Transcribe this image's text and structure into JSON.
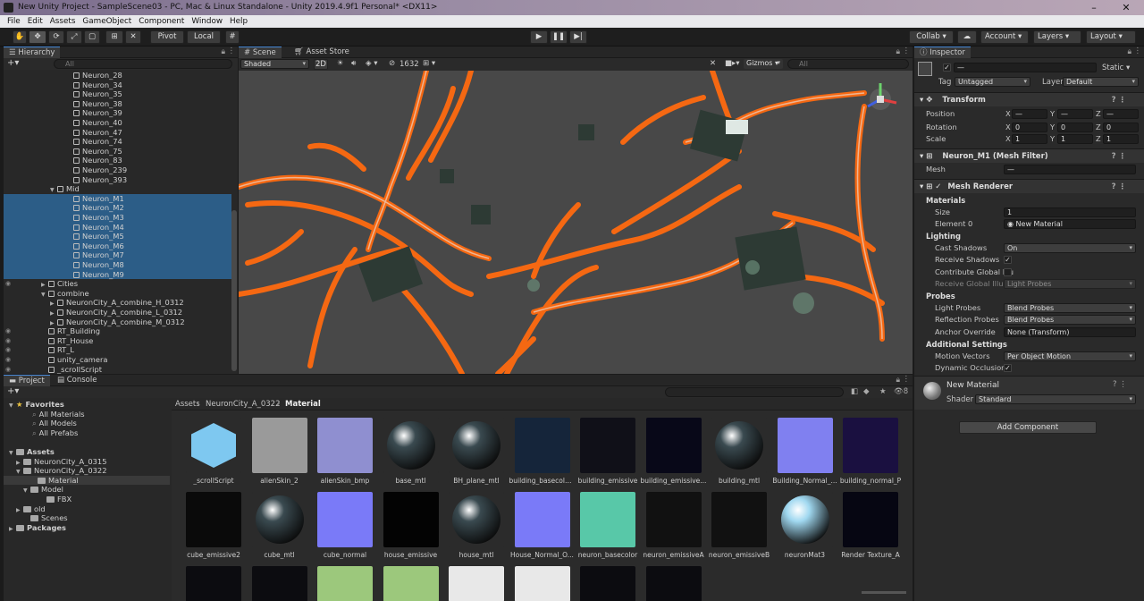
{
  "window": {
    "title": "New Unity Project - SampleScene03 - PC, Mac & Linux Standalone - Unity 2019.4.9f1 Personal* <DX11>"
  },
  "menu": [
    "File",
    "Edit",
    "Assets",
    "GameObject",
    "Component",
    "Window",
    "Help"
  ],
  "toolbar": {
    "pivot": "Pivot",
    "local": "Local",
    "collab": "Collab ▾",
    "account": "Account",
    "layers": "Layers",
    "layout": "Layout"
  },
  "hierarchy": {
    "tab": "Hierarchy",
    "search": "All",
    "rows": [
      {
        "label": "Neuron_28",
        "indent": 70,
        "sel": false
      },
      {
        "label": "Neuron_34",
        "indent": 70,
        "sel": false
      },
      {
        "label": "Neuron_35",
        "indent": 70,
        "sel": false
      },
      {
        "label": "Neuron_38",
        "indent": 70,
        "sel": false
      },
      {
        "label": "Neuron_39",
        "indent": 70,
        "sel": false
      },
      {
        "label": "Neuron_40",
        "indent": 70,
        "sel": false
      },
      {
        "label": "Neuron_47",
        "indent": 70,
        "sel": false
      },
      {
        "label": "Neuron_74",
        "indent": 70,
        "sel": false
      },
      {
        "label": "Neuron_75",
        "indent": 70,
        "sel": false
      },
      {
        "label": "Neuron_83",
        "indent": 70,
        "sel": false
      },
      {
        "label": "Neuron_239",
        "indent": 70,
        "sel": false
      },
      {
        "label": "Neuron_393",
        "indent": 70,
        "sel": false
      },
      {
        "label": "Mid",
        "indent": 52,
        "sel": false,
        "arrow": "▼"
      },
      {
        "label": "Neuron_M1",
        "indent": 70,
        "sel": true
      },
      {
        "label": "Neuron_M2",
        "indent": 70,
        "sel": true
      },
      {
        "label": "Neuron_M3",
        "indent": 70,
        "sel": true
      },
      {
        "label": "Neuron_M4",
        "indent": 70,
        "sel": true
      },
      {
        "label": "Neuron_M5",
        "indent": 70,
        "sel": true
      },
      {
        "label": "Neuron_M6",
        "indent": 70,
        "sel": true
      },
      {
        "label": "Neuron_M7",
        "indent": 70,
        "sel": true
      },
      {
        "label": "Neuron_M8",
        "indent": 70,
        "sel": true
      },
      {
        "label": "Neuron_M9",
        "indent": 70,
        "sel": true
      },
      {
        "label": "Cities",
        "indent": 42,
        "sel": false,
        "arrow": "▶",
        "eye": true
      },
      {
        "label": "combine",
        "indent": 42,
        "sel": false,
        "arrow": "▼"
      },
      {
        "label": "NeuronCity_A_combine_H_0312",
        "indent": 52,
        "sel": false,
        "arrow": "▶"
      },
      {
        "label": "NeuronCity_A_combine_L_0312",
        "indent": 52,
        "sel": false,
        "arrow": "▶"
      },
      {
        "label": "NeuronCity_A_combine_M_0312",
        "indent": 52,
        "sel": false,
        "arrow": "▶"
      },
      {
        "label": "RT_Building",
        "indent": 42,
        "sel": false,
        "eye": true
      },
      {
        "label": "RT_House",
        "indent": 42,
        "sel": false,
        "eye": true
      },
      {
        "label": "RT_L",
        "indent": 42,
        "sel": false,
        "eye": true
      },
      {
        "label": "unity_camera",
        "indent": 42,
        "sel": false,
        "eye": true
      },
      {
        "label": "_scrollScript",
        "indent": 42,
        "sel": false,
        "eye": true
      }
    ]
  },
  "scene": {
    "tab_scene": "Scene",
    "tab_store": "Asset Store",
    "shading": "Shaded",
    "mode2d": "2D",
    "count": "1632",
    "gizmos": "Gizmos ▾",
    "search": "All"
  },
  "inspector": {
    "tab": "Inspector",
    "name": "—",
    "static": "Static ▾",
    "tag_label": "Tag",
    "tag": "Untagged",
    "layer_label": "Layer",
    "layer": "Default",
    "transform": "Transform",
    "position": "Position",
    "rotation": "Rotation",
    "scale": "Scale",
    "pos": [
      "—",
      "—",
      "—"
    ],
    "rot": [
      "0",
      "0",
      "0"
    ],
    "scl": [
      "1",
      "1",
      "1"
    ],
    "meshfilter": "Neuron_M1 (Mesh Filter)",
    "mesh_label": "Mesh",
    "mesh_val": "—",
    "meshrenderer": "Mesh Renderer",
    "materials": "Materials",
    "size_label": "Size",
    "size": "1",
    "element0": "Element 0",
    "element0_val": "New Material",
    "lighting": "Lighting",
    "cast": "Cast Shadows",
    "cast_val": "On",
    "receive": "Receive Shadows",
    "contrib": "Contribute Global Illu",
    "recgi": "Receive Global Illum",
    "recgi_val": "Light Probes",
    "probes": "Probes",
    "lightp": "Light Probes",
    "lightp_val": "Blend Probes",
    "reflp": "Reflection Probes",
    "reflp_val": "Blend Probes",
    "anchor": "Anchor Override",
    "anchor_val": "None (Transform)",
    "additional": "Additional Settings",
    "motion": "Motion Vectors",
    "motion_val": "Per Object Motion",
    "dynocc": "Dynamic Occlusion",
    "matname": "New Material",
    "shader_label": "Shader",
    "shader": "Standard",
    "addcomp": "Add Component"
  },
  "project": {
    "tab_project": "Project",
    "tab_console": "Console",
    "tree": [
      {
        "label": "Favorites",
        "indent": 6,
        "bold": true,
        "arrow": "▼",
        "star": true
      },
      {
        "label": "All Materials",
        "indent": 24
      },
      {
        "label": "All Models",
        "indent": 24
      },
      {
        "label": "All Prefabs",
        "indent": 24
      },
      {
        "label": "",
        "indent": 0
      },
      {
        "label": "Assets",
        "indent": 6,
        "bold": true,
        "arrow": "▼",
        "folder": true
      },
      {
        "label": "NeuronCity_A_0315",
        "indent": 14,
        "arrow": "▶",
        "folder": true
      },
      {
        "label": "NeuronCity_A_0322",
        "indent": 14,
        "arrow": "▼",
        "folder": true
      },
      {
        "label": "Material",
        "indent": 30,
        "folder": true,
        "sel": true
      },
      {
        "label": "Model",
        "indent": 22,
        "arrow": "▼",
        "folder": true
      },
      {
        "label": "FBX",
        "indent": 40,
        "folder": true
      },
      {
        "label": "old",
        "indent": 14,
        "arrow": "▶",
        "folder": true
      },
      {
        "label": "Scenes",
        "indent": 22,
        "folder": true
      },
      {
        "label": "Packages",
        "indent": 6,
        "bold": true,
        "arrow": "▶",
        "folder": true
      }
    ],
    "breadcrumb": [
      "Assets",
      "NeuronCity_A_0322",
      "Material"
    ],
    "assets_row1": [
      "_scrollScript",
      "alienSkin_2",
      "alienSkin_bmp",
      "base_mtl",
      "BH_plane_mtl",
      "building_basecolo...",
      "building_emissive",
      "building_emissive...",
      "building_mtl",
      "Building_Normal_...",
      "building_normal_P"
    ],
    "assets_row2": [
      "cube_emissive2",
      "cube_mtl",
      "cube_normal",
      "house_emissive",
      "house_mtl",
      "House_Normal_O...",
      "neuron_basecolor",
      "neuron_emissiveA",
      "neuron_emissiveB",
      "neuronMat3",
      "Render Texture_A"
    ],
    "badge": "8",
    "colors": {
      "row1": [
        "#7ec8f0",
        "#9a9a9a",
        "#8f8fd0",
        "#0d0d0d",
        "#222",
        "#15253a",
        "#101018",
        "#080818",
        "#0d0d0d",
        "#8080f0",
        "#1a1040"
      ],
      "row2": [
        "#0a0a0a",
        "#1d1d1d",
        "#7a7af8",
        "#030303",
        "#1c1c1c",
        "#7a7af8",
        "#58c8a8",
        "#111",
        "#111",
        "#a0d8f0",
        "#060612"
      ]
    }
  }
}
